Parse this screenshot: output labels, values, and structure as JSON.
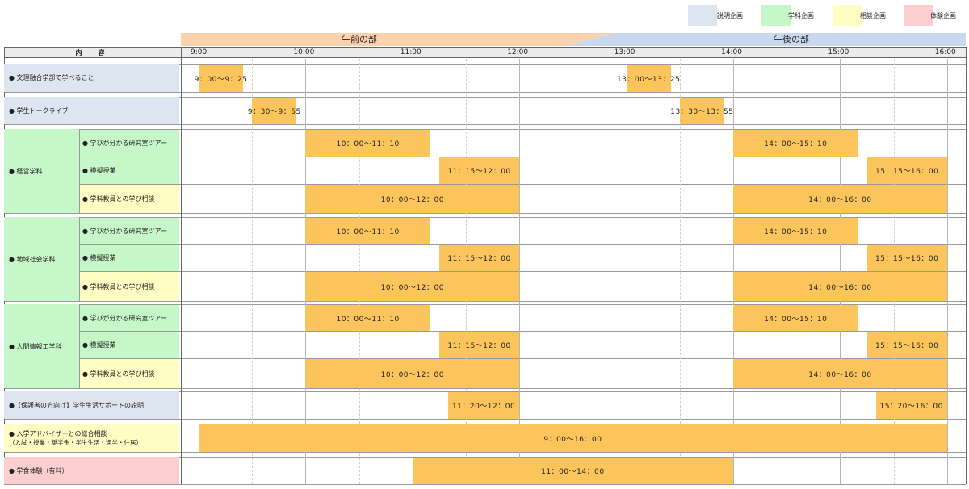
{
  "colors": {
    "description": "#dde6f0",
    "department": "#c6f7c9",
    "consultation": "#fffdc4",
    "experience": "#fbcfcf",
    "event_bar": "#fbc55c",
    "am_band": "#fbd1ae",
    "pm_band": "#c7d8ef"
  },
  "legend": [
    {
      "label": "説明企画",
      "color_key": "description"
    },
    {
      "label": "学科企画",
      "color_key": "department"
    },
    {
      "label": "相談企画",
      "color_key": "consultation"
    },
    {
      "label": "体験企画",
      "color_key": "experience"
    }
  ],
  "bands": {
    "am": "午前の部",
    "pm": "午後の部"
  },
  "header": {
    "content": "内　容"
  },
  "time_ticks": [
    {
      "label": "9:00",
      "hour": 9
    },
    {
      "label": "10:00",
      "hour": 10
    },
    {
      "label": "11:00",
      "hour": 11
    },
    {
      "label": "12:00",
      "hour": 12
    },
    {
      "label": "13:00",
      "hour": 13
    },
    {
      "label": "14:00",
      "hour": 14
    },
    {
      "label": "15:00",
      "hour": 15
    },
    {
      "label": "16:00",
      "hour": 16
    }
  ],
  "rows": [
    {
      "type": "single",
      "label": "● 文理融合学部で学べること",
      "color_key": "description",
      "events": [
        {
          "label": "9：00〜9：25",
          "start": 9.0,
          "end": 9.4167
        },
        {
          "label": "13：00〜13：25",
          "start": 13.0,
          "end": 13.4167
        }
      ]
    },
    {
      "type": "single",
      "label": "● 学生トークライブ",
      "color_key": "description",
      "events": [
        {
          "label": "9：30〜9：55",
          "start": 9.5,
          "end": 9.9167
        },
        {
          "label": "13：30〜13：55",
          "start": 13.5,
          "end": 13.9167
        }
      ]
    },
    {
      "type": "group",
      "label": "● 経営学科",
      "color_key": "department",
      "subs": [
        {
          "label": "● 学びが分かる研究室ツアー",
          "color_key": "department",
          "events": [
            {
              "label": "10：00〜11：10",
              "start": 10.0,
              "end": 11.1667
            },
            {
              "label": "14：00〜15：10",
              "start": 14.0,
              "end": 15.1667
            }
          ]
        },
        {
          "label": "● 模擬授業",
          "color_key": "department",
          "events": [
            {
              "label": "11：15〜12：00",
              "start": 11.25,
              "end": 12.0
            },
            {
              "label": "15：15〜16：00",
              "start": 15.25,
              "end": 16.0
            }
          ]
        },
        {
          "label": "● 学科教員との学び相談",
          "color_key": "consultation",
          "events": [
            {
              "label": "10：00〜12：00",
              "start": 10.0,
              "end": 12.0
            },
            {
              "label": "14：00〜16：00",
              "start": 14.0,
              "end": 16.0
            }
          ]
        }
      ]
    },
    {
      "type": "group",
      "label": "● 地域社会学科",
      "color_key": "department",
      "subs": [
        {
          "label": "● 学びが分かる研究室ツアー",
          "color_key": "department",
          "events": [
            {
              "label": "10：00〜11：10",
              "start": 10.0,
              "end": 11.1667
            },
            {
              "label": "14：00〜15：10",
              "start": 14.0,
              "end": 15.1667
            }
          ]
        },
        {
          "label": "● 模擬授業",
          "color_key": "department",
          "events": [
            {
              "label": "11：15〜12：00",
              "start": 11.25,
              "end": 12.0
            },
            {
              "label": "15：15〜16：00",
              "start": 15.25,
              "end": 16.0
            }
          ]
        },
        {
          "label": "● 学科教員との学び相談",
          "color_key": "consultation",
          "events": [
            {
              "label": "10：00〜12：00",
              "start": 10.0,
              "end": 12.0
            },
            {
              "label": "14：00〜16：00",
              "start": 14.0,
              "end": 16.0
            }
          ]
        }
      ]
    },
    {
      "type": "group",
      "label": "● 人間情報工学科",
      "color_key": "department",
      "subs": [
        {
          "label": "● 学びが分かる研究室ツアー",
          "color_key": "department",
          "events": [
            {
              "label": "10：00〜11：10",
              "start": 10.0,
              "end": 11.1667
            },
            {
              "label": "14：00〜15：10",
              "start": 14.0,
              "end": 15.1667
            }
          ]
        },
        {
          "label": "● 模擬授業",
          "color_key": "department",
          "events": [
            {
              "label": "11：15〜12：00",
              "start": 11.25,
              "end": 12.0
            },
            {
              "label": "15：15〜16：00",
              "start": 15.25,
              "end": 16.0
            }
          ]
        },
        {
          "label": "● 学科教員との学び相談",
          "color_key": "consultation",
          "events": [
            {
              "label": "10：00〜12：00",
              "start": 10.0,
              "end": 12.0
            },
            {
              "label": "14：00〜16：00",
              "start": 14.0,
              "end": 16.0
            }
          ]
        }
      ]
    },
    {
      "type": "single",
      "label": "●【保護者の方向け】学生生活サポートの説明",
      "color_key": "description",
      "events": [
        {
          "label": "11：20〜12：00",
          "start": 11.3333,
          "end": 12.0
        },
        {
          "label": "15：20〜16：00",
          "start": 15.3333,
          "end": 16.0
        }
      ]
    },
    {
      "type": "single",
      "label": "● 入学アドバイザーとの総合相談",
      "sublabel": "（入試・授業・奨学金・学生生活・通学・住居）",
      "color_key": "consultation",
      "events": [
        {
          "label": "9：00〜16：00",
          "start": 9.0,
          "end": 16.0
        }
      ]
    },
    {
      "type": "single",
      "label": "● 学食体験（有料）",
      "color_key": "experience",
      "events": [
        {
          "label": "11：00〜14：00",
          "start": 11.0,
          "end": 14.0
        }
      ]
    }
  ]
}
